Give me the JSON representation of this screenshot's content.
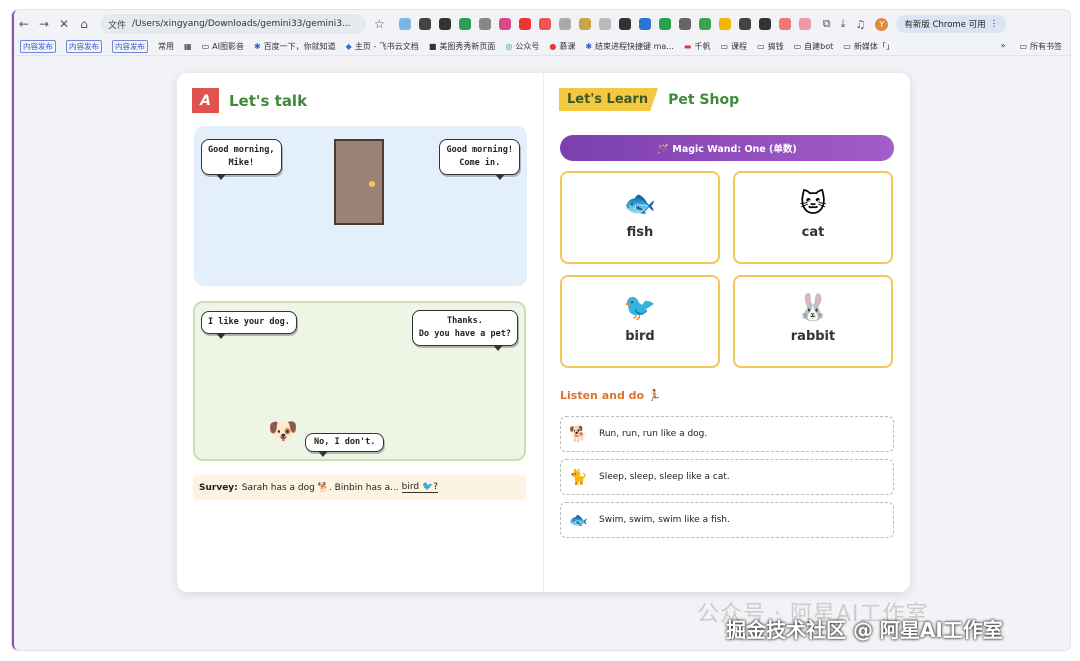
{
  "browser": {
    "nav": {
      "back": "←",
      "forward": "→",
      "stop": "✕",
      "home": "⌂"
    },
    "address": {
      "prefix": "文件",
      "url": "/Users/xingyang/Downloads/gemini33/gemini3..."
    },
    "new_chrome": "有新版 Chrome 可用",
    "avatar_letter": "Y"
  },
  "bookmarks": {
    "chips": [
      "内容发布",
      "内容发布",
      "内容发布"
    ],
    "items": [
      "常用",
      "AI图影音",
      "百度一下，你就知道",
      "主页 - 飞书云文档",
      "美图秀秀新页面",
      "公众号",
      "慕课",
      "结束进程快捷键 ma...",
      "千帆",
      "课程",
      "搞钱",
      "自建bot",
      "新媒体「」"
    ],
    "more": "»",
    "all": "所有书签"
  },
  "left": {
    "badge": "A",
    "title": "Let's talk",
    "scene1": {
      "bubble_left": [
        "Good morning,",
        "Mike!"
      ],
      "bubble_right": [
        "Good morning!",
        "Come in."
      ]
    },
    "scene2": {
      "bubble_left": "I like your dog.",
      "bubble_right": [
        "Thanks.",
        "Do you have a pet?"
      ],
      "bubble_dog": "No, I don't.",
      "dog_emoji": "🐶"
    },
    "survey": {
      "label": "Survey:",
      "text": "Sarah has a dog 🐕. Binbin has a...",
      "answer": "bird 🐦?"
    }
  },
  "right": {
    "badge": "Let's Learn",
    "title": "Pet Shop",
    "wand": "🪄 Magic Wand: One (单数)",
    "cards": [
      {
        "emoji": "🐟",
        "label": "fish"
      },
      {
        "emoji": "🐱",
        "label": "cat"
      },
      {
        "emoji": "🐦",
        "label": "bird"
      },
      {
        "emoji": "🐰",
        "label": "rabbit"
      }
    ],
    "listen_title": "Listen and do 🏃",
    "activities": [
      {
        "emoji": "🐕",
        "text": "Run, run, run like a dog."
      },
      {
        "emoji": "🐈",
        "text": "Sleep, sleep, sleep like a cat."
      },
      {
        "emoji": "🐟",
        "text": "Swim, swim, swim like a fish."
      }
    ]
  },
  "watermark": {
    "line1": "公众号 · 阿星AI工作室",
    "line2": "掘金技术社区 @ 阿星AI工作室"
  }
}
